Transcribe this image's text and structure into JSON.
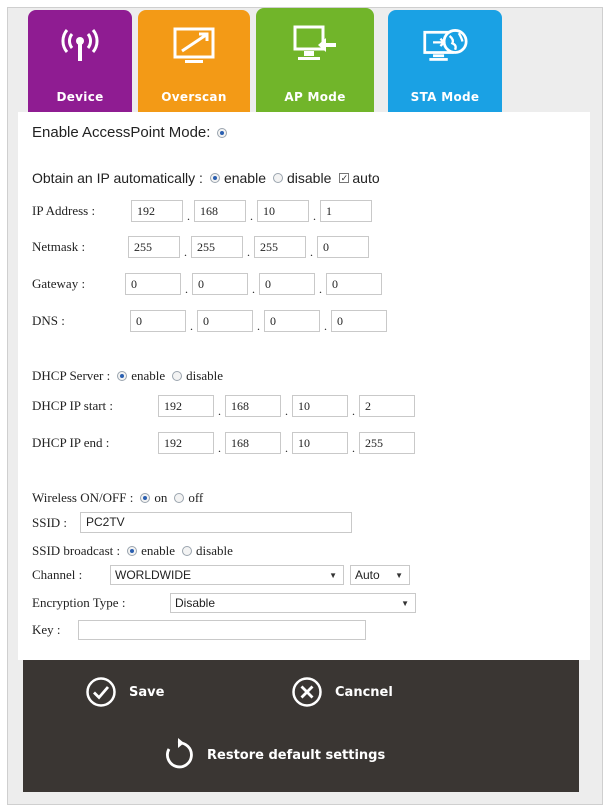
{
  "tabs": [
    {
      "label": "Device",
      "icon": "wifi-antenna-icon",
      "color": "#8f1c92"
    },
    {
      "label": "Overscan",
      "icon": "monitor-diagonal-icon",
      "color": "#f39a16"
    },
    {
      "label": "AP Mode",
      "icon": "monitor-arrow-icon",
      "color": "#71b52a",
      "active": true
    },
    {
      "label": "STA Mode",
      "icon": "monitor-globe-icon",
      "color": "#1aa1e4"
    }
  ],
  "ap": {
    "enable_label": "Enable AccessPoint Mode:",
    "obtain_label": "Obtain an IP automatically :",
    "opt_enable": "enable",
    "opt_disable": "disable",
    "opt_auto": "auto",
    "ip": {
      "label": "IP Address :",
      "values": [
        "192",
        "168",
        "10",
        "1"
      ]
    },
    "netmask": {
      "label": "Netmask :",
      "values": [
        "255",
        "255",
        "255",
        "0"
      ]
    },
    "gateway": {
      "label": "Gateway :",
      "values": [
        "0",
        "0",
        "0",
        "0"
      ]
    },
    "dns": {
      "label": "DNS :",
      "values": [
        "0",
        "0",
        "0",
        "0"
      ]
    }
  },
  "dhcp": {
    "label": "DHCP Server :",
    "opt_enable": "enable",
    "opt_disable": "disable",
    "start": {
      "label": "DHCP IP start :",
      "values": [
        "192",
        "168",
        "10",
        "2"
      ]
    },
    "end": {
      "label": "DHCP IP end :",
      "values": [
        "192",
        "168",
        "10",
        "255"
      ]
    }
  },
  "wireless": {
    "label": "Wireless ON/OFF :",
    "opt_on": "on",
    "opt_off": "off",
    "ssid_label": "SSID :",
    "ssid_value": "PC2TV",
    "broadcast_label": "SSID broadcast :",
    "opt_enable": "enable",
    "opt_disable": "disable",
    "channel_label": "Channel :",
    "channel_value": "WORLDWIDE",
    "channel_auto": "Auto",
    "encryption_label": "Encryption Type :",
    "encryption_value": "Disable",
    "key_label": "Key :",
    "key_value": ""
  },
  "actions": {
    "save": "Save",
    "cancel": "Cancnel",
    "restore": "Restore default settings"
  }
}
